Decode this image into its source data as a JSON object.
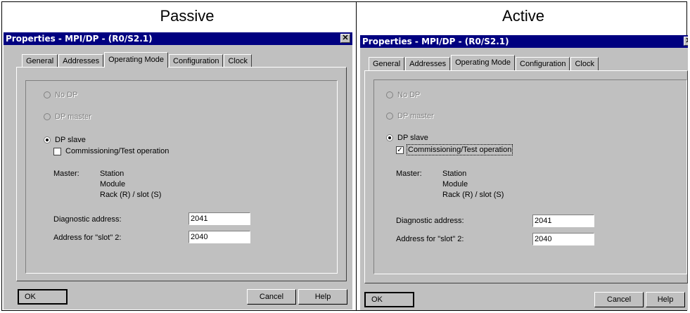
{
  "captions": {
    "passive": "Passive",
    "active": "Active"
  },
  "colors": {
    "titlebar": "#000080",
    "face": "#c0c0c0",
    "disabled_text": "#808080"
  },
  "icons": {
    "close": "close-icon"
  },
  "passive": {
    "title": "Properties - MPI/DP - (R0/S2.1)",
    "close_glyph": "✕",
    "tabs": [
      "General",
      "Addresses",
      "Operating Mode",
      "Configuration",
      "Clock"
    ],
    "active_tab": "Operating Mode",
    "options": {
      "no_dp": "No DP",
      "dp_master": "DP master",
      "dp_slave": "DP slave",
      "selected": "DP slave"
    },
    "commissioning": {
      "label": "Commissioning/Test operation",
      "checked": false,
      "check_glyph": ""
    },
    "master_label": "Master:",
    "master_lines": {
      "station": "Station",
      "module": "Module",
      "rack": "Rack (R) / slot (S)"
    },
    "diag_label": "Diagnostic address:",
    "diag_value": "2041",
    "slot_label": "Address for \"slot\" 2:",
    "slot_value": "2040",
    "buttons": {
      "ok": "OK",
      "cancel": "Cancel",
      "help": "Help"
    }
  },
  "active": {
    "title": "Properties - MPI/DP - (R0/S2.1)",
    "close_glyph": "✕",
    "tabs": [
      "General",
      "Addresses",
      "Operating Mode",
      "Configuration",
      "Clock"
    ],
    "active_tab": "Operating Mode",
    "options": {
      "no_dp": "No DP",
      "dp_master": "DP master",
      "dp_slave": "DP slave",
      "selected": "DP slave"
    },
    "commissioning": {
      "label": "Commissioning/Test operation",
      "checked": true,
      "check_glyph": "✓"
    },
    "master_label": "Master:",
    "master_lines": {
      "station": "Station",
      "module": "Module",
      "rack": "Rack (R) / slot (S)"
    },
    "diag_label": "Diagnostic address:",
    "diag_value": "2041",
    "slot_label": "Address for \"slot\" 2:",
    "slot_value": "2040",
    "buttons": {
      "ok": "OK",
      "cancel": "Cancel",
      "help": "Help"
    }
  }
}
